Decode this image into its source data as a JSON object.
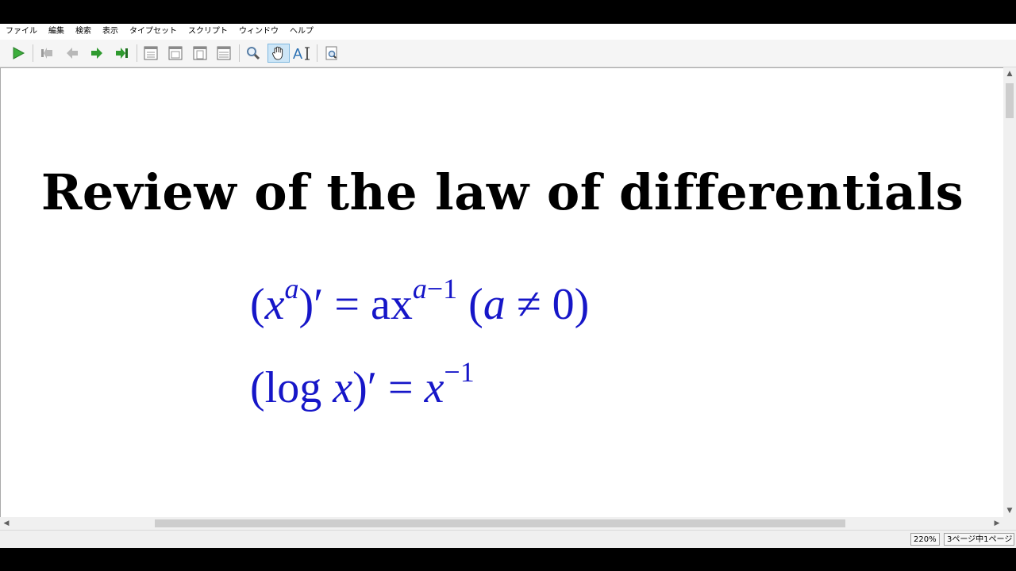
{
  "menu": [
    "ファイル",
    "編集",
    "検索",
    "表示",
    "タイプセット",
    "スクリプト",
    "ウィンドウ",
    "ヘルプ"
  ],
  "toolbar": {
    "buttons": [
      "typeset-icon",
      "first-page-icon",
      "prev-page-icon",
      "next-page-icon",
      "last-page-icon",
      "layout-single-icon",
      "layout-double-icon",
      "layout-continuous-icon",
      "fit-width-icon",
      "magnify-icon",
      "hand-tool-icon",
      "text-select-icon",
      "find-icon"
    ],
    "active": "hand-tool-icon",
    "colors": {
      "play": "#3cae3c",
      "nav": "#2f9a2f",
      "active_bg": "#cde6f7"
    }
  },
  "document": {
    "title": "Review of the law of differentials",
    "equation1": {
      "base": "(x",
      "sup1": "a",
      "mid": ")′ = ax",
      "sup2": "a−1",
      "cond": " (a ≠ 0)"
    },
    "equation2": {
      "text": "(log x)′ = x",
      "sup": "−1"
    },
    "math_color": "#1616c8"
  },
  "status": {
    "zoom": "220%",
    "page": "3ページ中1ページ"
  }
}
